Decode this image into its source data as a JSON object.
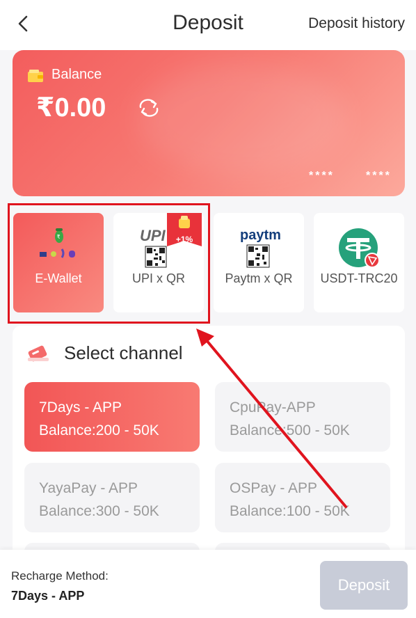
{
  "header": {
    "title": "Deposit",
    "history_link": "Deposit history"
  },
  "balance": {
    "label": "Balance",
    "amount": "₹0.00",
    "masked_1": "****",
    "masked_2": "****"
  },
  "payment_tabs": [
    {
      "label": "E-Wallet",
      "active": true,
      "icon": "e-wallet-icon"
    },
    {
      "label": "UPI x QR",
      "active": false,
      "icon": "upi-qr-icon",
      "badge": "+1%"
    },
    {
      "label": "Paytm x QR",
      "active": false,
      "icon": "paytm-qr-icon"
    },
    {
      "label": "USDT-TRC20",
      "active": false,
      "icon": "tether-icon"
    }
  ],
  "upi_logo_text": "UPI",
  "paytm_logo_text": "paytm",
  "channel_section": {
    "title": "Select channel",
    "channels": [
      {
        "name": "7Days - APP",
        "range": "Balance:200 - 50K",
        "active": true
      },
      {
        "name": "CpuPay-APP",
        "range": "Balance:500 - 50K",
        "active": false
      },
      {
        "name": "YayaPay - APP",
        "range": "Balance:300 - 50K",
        "active": false
      },
      {
        "name": "OSPay - APP",
        "range": "Balance:100 - 50K",
        "active": false
      }
    ]
  },
  "bottom_bar": {
    "method_label": "Recharge Method:",
    "method_value": "7Days - APP",
    "deposit_label": "Deposit"
  },
  "colors": {
    "accent": "#f35d5d",
    "highlight": "#e0141e",
    "disabled_button": "#c8ccd8"
  }
}
